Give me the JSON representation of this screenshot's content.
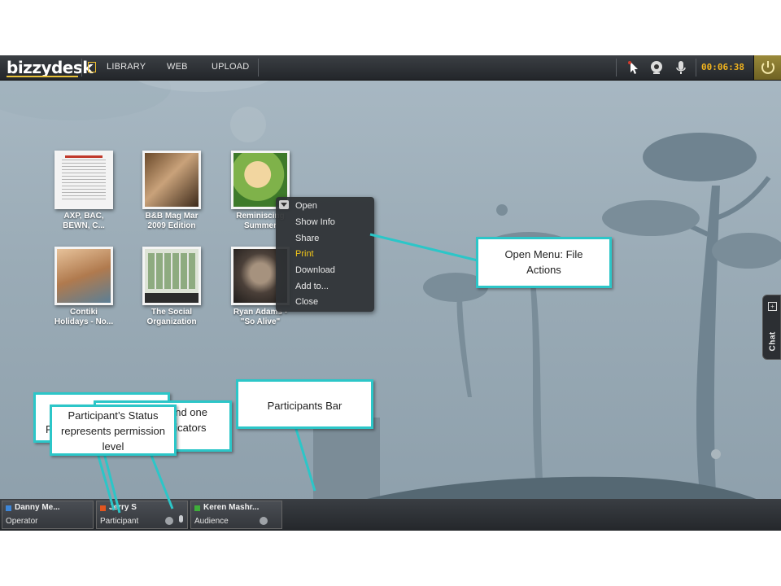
{
  "toolbar": {
    "logo": "bizzydesk",
    "nav": [
      "LIBRARY",
      "WEB",
      "UPLOAD"
    ],
    "timer": "00:06:38",
    "icons": [
      "new-document-icon",
      "pointer-icon",
      "webcam-icon",
      "microphone-icon",
      "power-icon"
    ]
  },
  "files": [
    {
      "name": "AXP, BAC, BEWN, C..."
    },
    {
      "name": "B&B Mag Mar 2009 Edition"
    },
    {
      "name": "Reminiscing Summer"
    },
    {
      "name": "Contiki Holidays - No..."
    },
    {
      "name": "The Social Organization"
    },
    {
      "name": "Ryan Adams - \"So Alive\""
    }
  ],
  "context_menu": {
    "items": [
      "Open",
      "Show Info",
      "Share",
      "Print",
      "Download",
      "Add to...",
      "Close"
    ],
    "highlighted": "Print"
  },
  "chat": {
    "label": "Chat"
  },
  "participants": [
    {
      "name": "Danny Me...",
      "role": "Operator",
      "status_color": "#3d86d8"
    },
    {
      "name": "Jerry S",
      "role": "Participant",
      "status_color": "#e2551f"
    },
    {
      "name": "Keren Mashr...",
      "role": "Audience",
      "status_color": "#3fae3a"
    }
  ],
  "callouts": {
    "open_menu": "Open Menu: File Actions",
    "participants_bar": "Participants Bar",
    "status": "Participant’s Status represents permission level",
    "indicators": "and one dicators",
    "partial": "P"
  },
  "colors": {
    "accent_timer": "#f2b41e",
    "callout_border": "#2cc6c8",
    "menu_highlight": "#f0c419"
  }
}
